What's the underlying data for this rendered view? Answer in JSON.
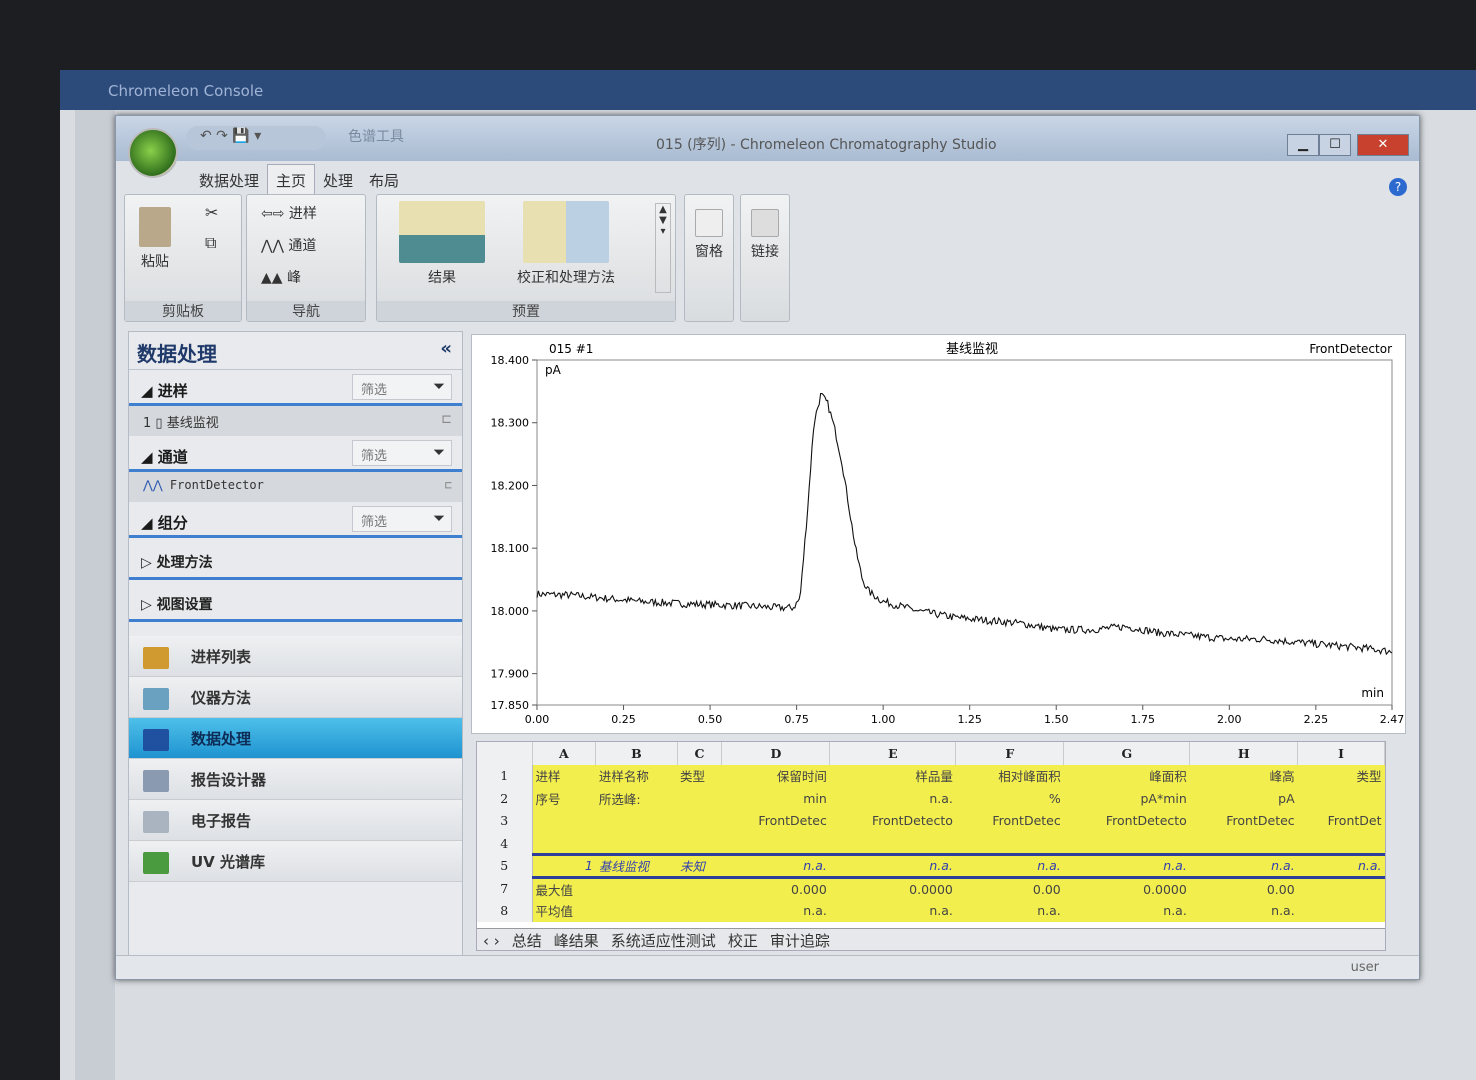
{
  "console": {
    "title": "Chromeleon Console"
  },
  "window": {
    "title": "015 (序列) - Chromeleon Chromatography Studio",
    "context_tool": "色谱工具",
    "min": "▁",
    "max": "☐",
    "close": "✕"
  },
  "tabs": [
    "数据处理",
    "主页",
    "处理",
    "布局"
  ],
  "ribbon": {
    "clipboard": {
      "label": "剪贴板",
      "paste": "粘贴"
    },
    "navigation": {
      "label": "导航",
      "injection": "进样",
      "channel": "通道",
      "peak": "峰"
    },
    "presets": {
      "label": "预置",
      "results": "结果",
      "calibration": "校正和处理方法"
    },
    "pane": "窗格",
    "link": "链接"
  },
  "nav": {
    "title": "数据处理",
    "collapse": "«",
    "sections": [
      {
        "label": "进样",
        "filter": "筛选",
        "item_index": "1",
        "item": "基线监视"
      },
      {
        "label": "通道",
        "filter": "筛选",
        "item": "FrontDetector"
      },
      {
        "label": "组分",
        "filter": "筛选"
      }
    ],
    "collapsed": [
      "处理方法",
      "视图设置"
    ],
    "items": [
      {
        "label": "进样列表",
        "color": "#d09a30"
      },
      {
        "label": "仪器方法",
        "color": "#6aa0c0"
      },
      {
        "label": "数据处理",
        "color": "#2050a0",
        "selected": true
      },
      {
        "label": "报告设计器",
        "color": "#8a9ab0"
      },
      {
        "label": "电子报告",
        "color": "#aab4c0"
      },
      {
        "label": "UV 光谱库",
        "color": "#4a9a40"
      }
    ]
  },
  "chart_data": {
    "type": "line",
    "title": "基线监视",
    "injection": "015 #1",
    "detector": "FrontDetector",
    "ylabel": "pA",
    "xlabel": "min",
    "xlim": [
      0,
      2.47
    ],
    "ylim": [
      17.85,
      18.4
    ],
    "xticks": [
      "0.00",
      "0.25",
      "0.50",
      "0.75",
      "1.00",
      "1.25",
      "1.50",
      "1.75",
      "2.00",
      "2.25",
      "2.47"
    ],
    "yticks": [
      "18.400",
      "18.300",
      "18.200",
      "18.100",
      "18.000",
      "17.900",
      "17.850"
    ],
    "x": [
      0,
      0.1,
      0.2,
      0.3,
      0.4,
      0.5,
      0.6,
      0.7,
      0.74,
      0.76,
      0.78,
      0.8,
      0.82,
      0.84,
      0.86,
      0.88,
      0.9,
      0.92,
      0.94,
      0.96,
      1.0,
      1.1,
      1.2,
      1.3,
      1.4,
      1.5,
      1.6,
      1.7,
      1.8,
      1.9,
      2.0,
      2.1,
      2.2,
      2.3,
      2.4,
      2.47
    ],
    "y": [
      18.027,
      18.025,
      18.02,
      18.015,
      18.012,
      18.01,
      18.008,
      18.005,
      18.005,
      18.02,
      18.15,
      18.3,
      18.345,
      18.33,
      18.29,
      18.24,
      18.17,
      18.1,
      18.05,
      18.03,
      18.015,
      18.0,
      17.99,
      17.985,
      17.98,
      17.97,
      17.97,
      17.975,
      17.965,
      17.96,
      17.955,
      17.955,
      17.95,
      17.945,
      17.94,
      17.935
    ]
  },
  "table": {
    "columns": [
      "",
      "A",
      "B",
      "C",
      "D",
      "E",
      "F",
      "G",
      "H",
      "I"
    ],
    "rows": [
      {
        "n": "1",
        "cells": [
          "进样",
          "进样名称",
          "类型",
          "保留时间",
          "样品量",
          "相对峰面积",
          "峰面积",
          "峰高",
          "类型"
        ]
      },
      {
        "n": "2",
        "cells": [
          "序号",
          "所选峰:",
          "",
          "min",
          "n.a.",
          "%",
          "pA*min",
          "pA",
          ""
        ]
      },
      {
        "n": "3",
        "cells": [
          "",
          "",
          "",
          "FrontDetec",
          "FrontDetecto",
          "FrontDetec",
          "FrontDetecto",
          "FrontDetec",
          "FrontDet"
        ]
      },
      {
        "n": "4",
        "cells": [
          "",
          "",
          "",
          "",
          "",
          "",
          "",
          "",
          ""
        ]
      },
      {
        "n": "5",
        "cells": [
          "1",
          "基线监视",
          "未知",
          "n.a.",
          "n.a.",
          "n.a.",
          "n.a.",
          "n.a.",
          "n.a."
        ]
      },
      {
        "n": "7",
        "cells": [
          "最大值",
          "",
          "",
          "0.000",
          "0.0000",
          "0.00",
          "0.0000",
          "0.00",
          ""
        ]
      },
      {
        "n": "8",
        "cells": [
          "平均值",
          "",
          "",
          "n.a.",
          "n.a.",
          "n.a.",
          "n.a.",
          "n.a.",
          ""
        ]
      }
    ],
    "sheets": [
      "总结",
      "峰结果",
      "系统适应性测试",
      "校正",
      "审计追踪"
    ]
  },
  "status": {
    "user": "user"
  }
}
